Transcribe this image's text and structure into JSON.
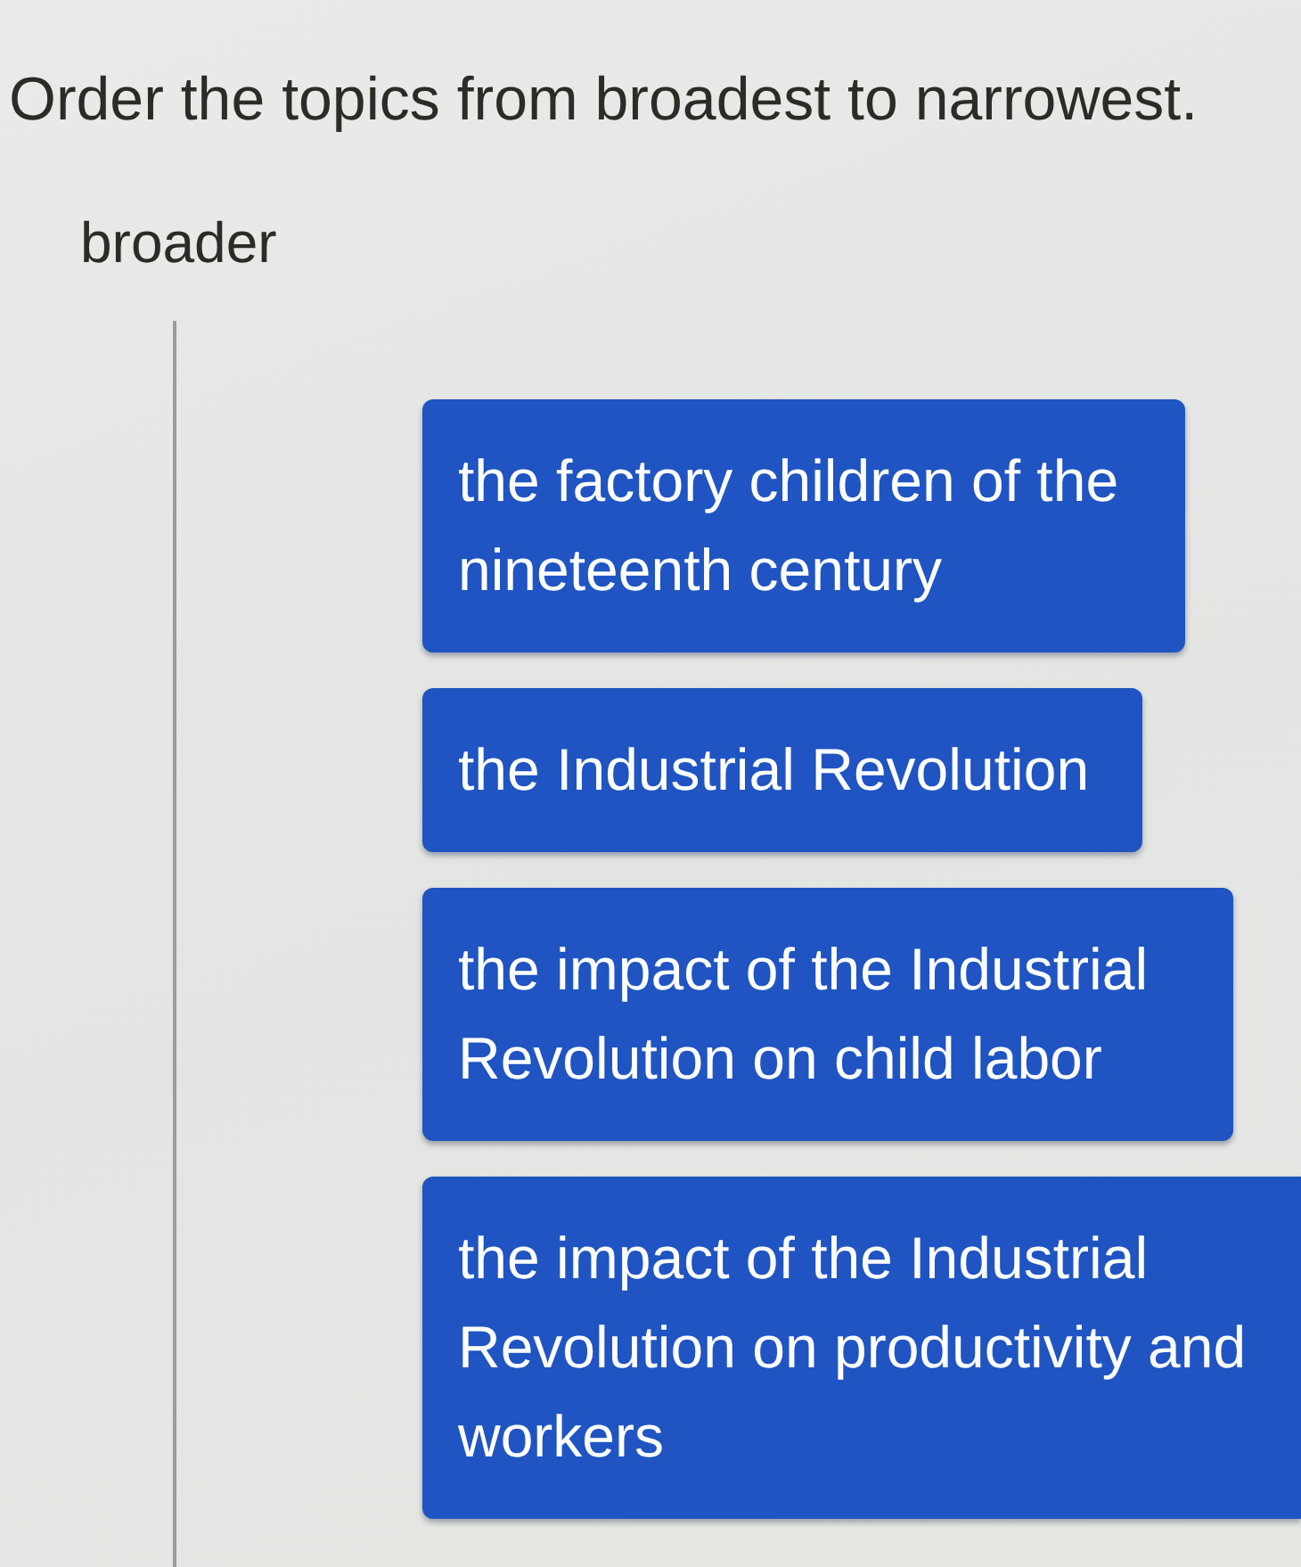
{
  "prompt": "Order the topics from broadest to narrowest.",
  "scale_label": "broader",
  "topics": [
    "the factory children of the nineteenth century",
    "the Industrial Revolution",
    "the impact of the Industrial Revolution on child labor",
    "the impact of the Industrial Revolution on productivity and workers"
  ]
}
